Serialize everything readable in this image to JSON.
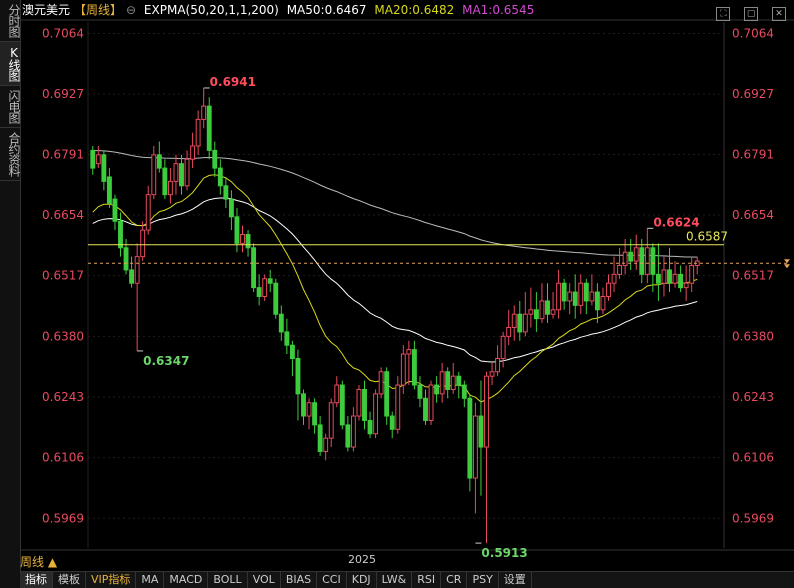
{
  "sidebar": {
    "tabs": [
      {
        "label": "分时图",
        "active": false
      },
      {
        "label": "K线图",
        "active": true
      },
      {
        "label": "闪电图",
        "active": false
      },
      {
        "label": "合约资料",
        "active": false
      }
    ]
  },
  "header": {
    "symbol": "澳元美元",
    "period": "【周线】",
    "indicator": "EXPMA(50,20,1,1,200)",
    "ma50": "MA50:0.6467",
    "ma20": "MA20:0.6482",
    "ma1": "MA1:0.6545"
  },
  "bottom": {
    "period_label": "周线 ▲",
    "year_label": "2025",
    "tabs": [
      "指标",
      "模板",
      "VIP指标",
      "MA",
      "MACD",
      "BOLL",
      "VOL",
      "BIAS",
      "CCI",
      "KDJ",
      "LW&",
      "RSI",
      "CR",
      "PSY",
      "设置"
    ]
  },
  "colors": {
    "up": "#e84a5f",
    "down": "#3dcc3d",
    "ma20": "#d9d91a",
    "ma50": "#ffffff",
    "ma200": "#bbbbbb",
    "axis_text": "#e84a5f",
    "hline": "#e8e85a"
  },
  "chart_data": {
    "type": "candlestick",
    "y_ticks": [
      "0.7064",
      "0.6927",
      "0.6791",
      "0.6654",
      "0.6517",
      "0.6380",
      "0.6243",
      "0.6106",
      "0.5969"
    ],
    "ylim": [
      0.592,
      0.709
    ],
    "annotations": [
      {
        "text": "0.6941",
        "value": 0.6941,
        "candle": 20,
        "kind": "high"
      },
      {
        "text": "0.6347",
        "value": 0.6347,
        "candle": 8,
        "kind": "low"
      },
      {
        "text": "0.6624",
        "value": 0.6624,
        "candle": 100,
        "kind": "high"
      },
      {
        "text": "0.5913",
        "value": 0.5913,
        "candle": 69,
        "kind": "low"
      },
      {
        "text": "0.6587",
        "value": 0.6587,
        "kind": "hline"
      }
    ],
    "dashed_last_price": 0.6545,
    "candles": [
      [
        0.68,
        0.676,
        0.681,
        0.6745
      ],
      [
        0.677,
        0.679,
        0.681,
        0.676
      ],
      [
        0.679,
        0.673,
        0.68,
        0.671
      ],
      [
        0.674,
        0.668,
        0.676,
        0.667
      ],
      [
        0.669,
        0.664,
        0.67,
        0.662
      ],
      [
        0.664,
        0.658,
        0.666,
        0.656
      ],
      [
        0.658,
        0.653,
        0.66,
        0.652
      ],
      [
        0.653,
        0.65,
        0.656,
        0.649
      ],
      [
        0.65,
        0.656,
        0.659,
        0.6347
      ],
      [
        0.656,
        0.662,
        0.664,
        0.655
      ],
      [
        0.662,
        0.67,
        0.672,
        0.661
      ],
      [
        0.67,
        0.679,
        0.681,
        0.669
      ],
      [
        0.679,
        0.676,
        0.682,
        0.675
      ],
      [
        0.676,
        0.67,
        0.678,
        0.669
      ],
      [
        0.67,
        0.673,
        0.676,
        0.668
      ],
      [
        0.673,
        0.677,
        0.679,
        0.67
      ],
      [
        0.677,
        0.672,
        0.679,
        0.67
      ],
      [
        0.672,
        0.678,
        0.68,
        0.671
      ],
      [
        0.678,
        0.681,
        0.684,
        0.676
      ],
      [
        0.681,
        0.687,
        0.689,
        0.679
      ],
      [
        0.687,
        0.69,
        0.6941,
        0.685
      ],
      [
        0.69,
        0.68,
        0.692,
        0.678
      ],
      [
        0.68,
        0.676,
        0.682,
        0.674
      ],
      [
        0.676,
        0.672,
        0.678,
        0.67
      ],
      [
        0.672,
        0.669,
        0.674,
        0.667
      ],
      [
        0.669,
        0.665,
        0.671,
        0.662
      ],
      [
        0.665,
        0.659,
        0.667,
        0.657
      ],
      [
        0.659,
        0.661,
        0.663,
        0.657
      ],
      [
        0.661,
        0.658,
        0.662,
        0.656
      ],
      [
        0.658,
        0.649,
        0.659,
        0.648
      ],
      [
        0.649,
        0.647,
        0.652,
        0.645
      ],
      [
        0.647,
        0.651,
        0.652,
        0.646
      ],
      [
        0.651,
        0.65,
        0.653,
        0.648
      ],
      [
        0.65,
        0.643,
        0.651,
        0.642
      ],
      [
        0.643,
        0.639,
        0.645,
        0.637
      ],
      [
        0.639,
        0.636,
        0.642,
        0.634
      ],
      [
        0.636,
        0.633,
        0.637,
        0.629
      ],
      [
        0.633,
        0.625,
        0.635,
        0.619
      ],
      [
        0.625,
        0.62,
        0.626,
        0.618
      ],
      [
        0.62,
        0.623,
        0.624,
        0.617
      ],
      [
        0.623,
        0.618,
        0.624,
        0.616
      ],
      [
        0.618,
        0.612,
        0.62,
        0.611
      ],
      [
        0.612,
        0.615,
        0.616,
        0.61
      ],
      [
        0.615,
        0.623,
        0.624,
        0.613
      ],
      [
        0.623,
        0.627,
        0.629,
        0.622
      ],
      [
        0.627,
        0.618,
        0.628,
        0.617
      ],
      [
        0.618,
        0.613,
        0.62,
        0.612
      ],
      [
        0.613,
        0.62,
        0.622,
        0.612
      ],
      [
        0.62,
        0.626,
        0.627,
        0.619
      ],
      [
        0.626,
        0.619,
        0.628,
        0.617
      ],
      [
        0.619,
        0.616,
        0.621,
        0.615
      ],
      [
        0.616,
        0.625,
        0.626,
        0.615
      ],
      [
        0.625,
        0.63,
        0.631,
        0.624
      ],
      [
        0.63,
        0.62,
        0.631,
        0.618
      ],
      [
        0.62,
        0.617,
        0.621,
        0.615
      ],
      [
        0.617,
        0.627,
        0.629,
        0.616
      ],
      [
        0.627,
        0.634,
        0.636,
        0.625
      ],
      [
        0.634,
        0.635,
        0.637,
        0.627
      ],
      [
        0.635,
        0.627,
        0.637,
        0.626
      ],
      [
        0.627,
        0.624,
        0.629,
        0.622
      ],
      [
        0.624,
        0.619,
        0.626,
        0.618
      ],
      [
        0.619,
        0.627,
        0.628,
        0.618
      ],
      [
        0.627,
        0.625,
        0.629,
        0.623
      ],
      [
        0.625,
        0.63,
        0.632,
        0.623
      ],
      [
        0.63,
        0.626,
        0.631,
        0.624
      ],
      [
        0.626,
        0.629,
        0.632,
        0.625
      ],
      [
        0.629,
        0.627,
        0.63,
        0.624
      ],
      [
        0.627,
        0.624,
        0.628,
        0.622
      ],
      [
        0.624,
        0.606,
        0.625,
        0.603
      ],
      [
        0.606,
        0.62,
        0.623,
        0.598
      ],
      [
        0.62,
        0.613,
        0.628,
        0.602
      ],
      [
        0.613,
        0.629,
        0.63,
        0.5913
      ],
      [
        0.629,
        0.63,
        0.632,
        0.627
      ],
      [
        0.63,
        0.633,
        0.636,
        0.629
      ],
      [
        0.633,
        0.638,
        0.639,
        0.631
      ],
      [
        0.638,
        0.64,
        0.644,
        0.636
      ],
      [
        0.64,
        0.643,
        0.645,
        0.637
      ],
      [
        0.643,
        0.639,
        0.646,
        0.637
      ],
      [
        0.639,
        0.643,
        0.648,
        0.638
      ],
      [
        0.643,
        0.644,
        0.649,
        0.64
      ],
      [
        0.644,
        0.642,
        0.648,
        0.639
      ],
      [
        0.642,
        0.646,
        0.65,
        0.641
      ],
      [
        0.646,
        0.643,
        0.65,
        0.641
      ],
      [
        0.643,
        0.644,
        0.648,
        0.642
      ],
      [
        0.644,
        0.65,
        0.653,
        0.642
      ],
      [
        0.65,
        0.646,
        0.651,
        0.644
      ],
      [
        0.646,
        0.648,
        0.65,
        0.643
      ],
      [
        0.648,
        0.645,
        0.652,
        0.642
      ],
      [
        0.645,
        0.65,
        0.652,
        0.643
      ],
      [
        0.65,
        0.646,
        0.651,
        0.643
      ],
      [
        0.646,
        0.648,
        0.652,
        0.645
      ],
      [
        0.648,
        0.644,
        0.65,
        0.641
      ],
      [
        0.644,
        0.647,
        0.649,
        0.643
      ],
      [
        0.647,
        0.65,
        0.652,
        0.646
      ],
      [
        0.65,
        0.652,
        0.656,
        0.648
      ],
      [
        0.652,
        0.654,
        0.658,
        0.651
      ],
      [
        0.654,
        0.657,
        0.66,
        0.652
      ],
      [
        0.657,
        0.655,
        0.66,
        0.653
      ],
      [
        0.655,
        0.658,
        0.661,
        0.653
      ],
      [
        0.658,
        0.652,
        0.66,
        0.65
      ],
      [
        0.652,
        0.658,
        0.6624,
        0.65
      ],
      [
        0.658,
        0.652,
        0.659,
        0.648
      ],
      [
        0.652,
        0.65,
        0.659,
        0.646
      ],
      [
        0.65,
        0.653,
        0.656,
        0.647
      ],
      [
        0.653,
        0.65,
        0.658,
        0.648
      ],
      [
        0.65,
        0.652,
        0.655,
        0.649
      ],
      [
        0.652,
        0.649,
        0.654,
        0.648
      ],
      [
        0.649,
        0.65,
        0.654,
        0.646
      ],
      [
        0.65,
        0.654,
        0.656,
        0.648
      ],
      [
        0.654,
        0.655,
        0.656,
        0.652
      ]
    ]
  }
}
